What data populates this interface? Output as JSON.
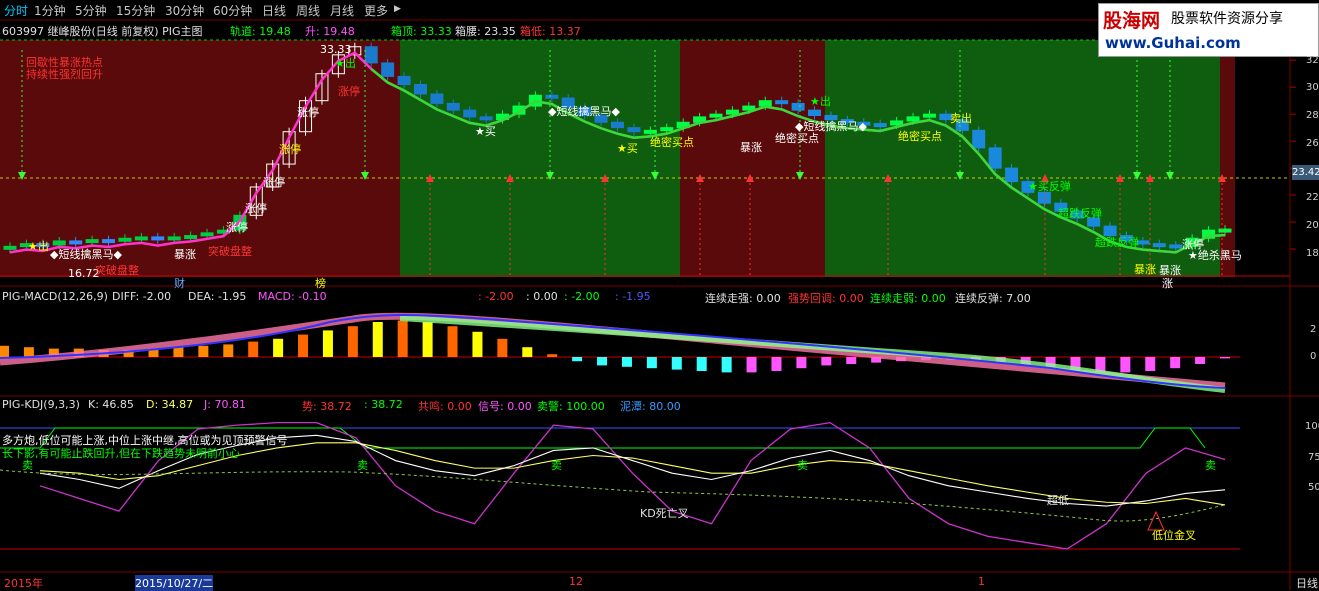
{
  "toolbar": {
    "tabs": [
      "分时",
      "1分钟",
      "5分钟",
      "15分钟",
      "30分钟",
      "60分钟",
      "日线",
      "周线",
      "月线",
      "更多"
    ],
    "active": "分时",
    "more_arrow": "▶"
  },
  "logo": {
    "brand": "股海网",
    "tagline": "股票软件资源分享",
    "url": "www.Guhai.com"
  },
  "main_header": {
    "stock": "603997 继峰股份(日线 前复权) PIG主图",
    "items": [
      {
        "label": "轨道: 19.48",
        "color": "#00ff00"
      },
      {
        "label": "升: 19.48",
        "color": "#ff55ff"
      },
      {
        "label": "箱顶: 33.33",
        "color": "#00ff00"
      },
      {
        "label": "箱腰: 23.35",
        "color": "#e0e0e0"
      },
      {
        "label": "箱低: 13.37",
        "color": "#ff3333"
      }
    ]
  },
  "price_axis": {
    "ticks": [
      "32",
      "30",
      "28",
      "26",
      "24",
      "22",
      "20",
      "18"
    ],
    "current": "23.42"
  },
  "annotations": {
    "top_left_red1": "回歇性暴涨热点",
    "top_left_red2": "持续性强烈回升",
    "peak": "33.33",
    "low": "16.72",
    "main_labels": [
      "★出",
      "涨停",
      "涨停",
      "涨停",
      "涨停",
      "涨停",
      "涨停",
      "暴涨",
      "突破盘整",
      "突破盘整",
      "◆短线擒黑马◆",
      "★出",
      "★买",
      "◆短线擒黑马◆",
      "★买",
      "绝密买点",
      "暴涨",
      "★出",
      "◆短线擒黑马◆",
      "绝密买点",
      "绝密买点",
      "卖出",
      "暴涨",
      "★买反弹",
      "超跌反弹",
      "超跌反弹",
      "★绝杀黑马",
      "涨停",
      "暴涨",
      "财",
      "榜",
      "涨"
    ]
  },
  "macd_header": {
    "items": [
      {
        "label": "PIG-MACD(12,26,9)",
        "color": "#e0e0e0"
      },
      {
        "label": "DIFF: -2.00",
        "color": "#e0e0e0"
      },
      {
        "label": "DEA: -1.95",
        "color": "#e0e0e0"
      },
      {
        "label": "MACD: -0.10",
        "color": "#ff55ff"
      },
      {
        "label": ": -2.00",
        "color": "#ff3333"
      },
      {
        "label": ": 0.00",
        "color": "#e0e0e0"
      },
      {
        "label": ": -2.00",
        "color": "#00ff00"
      },
      {
        "label": ": -1.95",
        "color": "#5555ff"
      },
      {
        "label": "连续走强: 0.00",
        "color": "#e0e0e0"
      },
      {
        "label": "强势回调: 0.00",
        "color": "#ff3333"
      },
      {
        "label": "连续走弱: 0.00",
        "color": "#00ff00"
      },
      {
        "label": "连续反弹: 7.00",
        "color": "#e0e0e0"
      }
    ],
    "axis": [
      "2",
      "0"
    ]
  },
  "kdj_header": {
    "items": [
      {
        "label": "PIG-KDJ(9,3,3)",
        "color": "#e0e0e0"
      },
      {
        "label": "K: 46.85",
        "color": "#e0e0e0"
      },
      {
        "label": "D: 34.87",
        "color": "#ffff66"
      },
      {
        "label": "J: 70.81",
        "color": "#ff55ff"
      },
      {
        "label": "势: 38.72",
        "color": "#ff3333"
      },
      {
        "label": ": 38.72",
        "color": "#00ff00"
      },
      {
        "label": "共鸣: 0.00",
        "color": "#ff3333"
      },
      {
        "label": "信号: 0.00",
        "color": "#ff55ff"
      },
      {
        "label": "卖警: 100.00",
        "color": "#00ff00"
      },
      {
        "label": "泥潭: 80.00",
        "color": "#3399ff"
      }
    ],
    "axis": [
      "100",
      "75",
      "50"
    ],
    "note1": "多方炮,低位可能上涨,中位上涨中继,高位或为见顶预警信号",
    "note2": "长下影,有可能止跌回升,但在下跌趋势未明前小心",
    "labels": [
      "卖",
      "卖",
      "卖",
      "卖",
      "卖",
      "KD死亡叉",
      "超低",
      "低位金叉"
    ]
  },
  "time_axis": {
    "labels": [
      "2015年",
      "2015/10/27/二",
      "12",
      "1"
    ],
    "right": "日线"
  },
  "chart_data": [
    {
      "type": "candlestick",
      "title": "603997 继峰股份(日线 前复权) PIG主图",
      "ylim": [
        16,
        33.5
      ],
      "close_series": [
        18.2,
        18.4,
        18.3,
        18.6,
        18.5,
        18.7,
        18.6,
        18.8,
        18.9,
        18.7,
        18.9,
        19.0,
        19.2,
        19.4,
        20.5,
        22.6,
        24.3,
        26.7,
        29.0,
        31.0,
        32.4,
        33.0,
        31.8,
        30.8,
        30.2,
        29.5,
        28.8,
        28.3,
        27.8,
        27.6,
        28.0,
        28.6,
        29.4,
        29.2,
        28.5,
        27.9,
        27.4,
        27.0,
        26.7,
        26.8,
        27.0,
        27.4,
        27.8,
        28.0,
        28.3,
        28.6,
        29.0,
        28.8,
        28.3,
        27.9,
        27.6,
        27.4,
        27.3,
        27.2,
        27.5,
        27.8,
        28.0,
        27.6,
        26.8,
        25.5,
        24.0,
        23.0,
        22.2,
        21.4,
        20.8,
        20.3,
        19.7,
        19.0,
        18.6,
        18.4,
        18.3,
        18.2,
        18.8,
        19.4,
        19.48
      ],
      "track": 19.48,
      "rise": 19.48,
      "box_top": 33.33,
      "box_mid": 23.35,
      "box_low": 13.37,
      "peak": 33.33,
      "low": 16.72
    },
    {
      "type": "bar",
      "title": "PIG-MACD(12,26,9)",
      "ylim": [
        -3.5,
        3
      ],
      "macd": [
        0.8,
        0.7,
        0.6,
        0.6,
        0.5,
        0.5,
        0.6,
        0.7,
        0.8,
        0.9,
        1.1,
        1.3,
        1.6,
        1.9,
        2.2,
        2.5,
        2.6,
        2.5,
        2.2,
        1.8,
        1.3,
        0.7,
        0.2,
        -0.3,
        -0.6,
        -0.7,
        -0.8,
        -0.9,
        -1.0,
        -1.1,
        -1.1,
        -1.0,
        -0.8,
        -0.6,
        -0.5,
        -0.4,
        -0.3,
        -0.2,
        -0.2,
        -0.3,
        -0.4,
        -0.6,
        -0.8,
        -1.0,
        -1.1,
        -1.1,
        -1.0,
        -0.8,
        -0.5,
        -0.1
      ],
      "diff": -2.0,
      "dea": -1.95
    },
    {
      "type": "line",
      "title": "PIG-KDJ(9,3,3)",
      "ylim": [
        0,
        110
      ],
      "k": [
        60,
        55,
        48,
        62,
        75,
        82,
        88,
        90,
        85,
        70,
        62,
        58,
        66,
        78,
        80,
        70,
        60,
        55,
        62,
        72,
        78,
        70,
        58,
        50,
        45,
        40,
        36,
        34,
        38,
        44,
        46.85
      ],
      "d": [
        62,
        60,
        55,
        58,
        66,
        74,
        80,
        84,
        84,
        78,
        70,
        64,
        64,
        70,
        74,
        72,
        66,
        60,
        60,
        66,
        70,
        68,
        62,
        56,
        50,
        45,
        40,
        37,
        36,
        40,
        34.87
      ],
      "j": [
        50,
        40,
        30,
        70,
        95,
        98,
        100,
        100,
        88,
        50,
        30,
        20,
        60,
        98,
        95,
        60,
        30,
        20,
        70,
        95,
        100,
        80,
        40,
        20,
        10,
        5,
        0,
        20,
        60,
        80,
        70.81
      ]
    }
  ]
}
